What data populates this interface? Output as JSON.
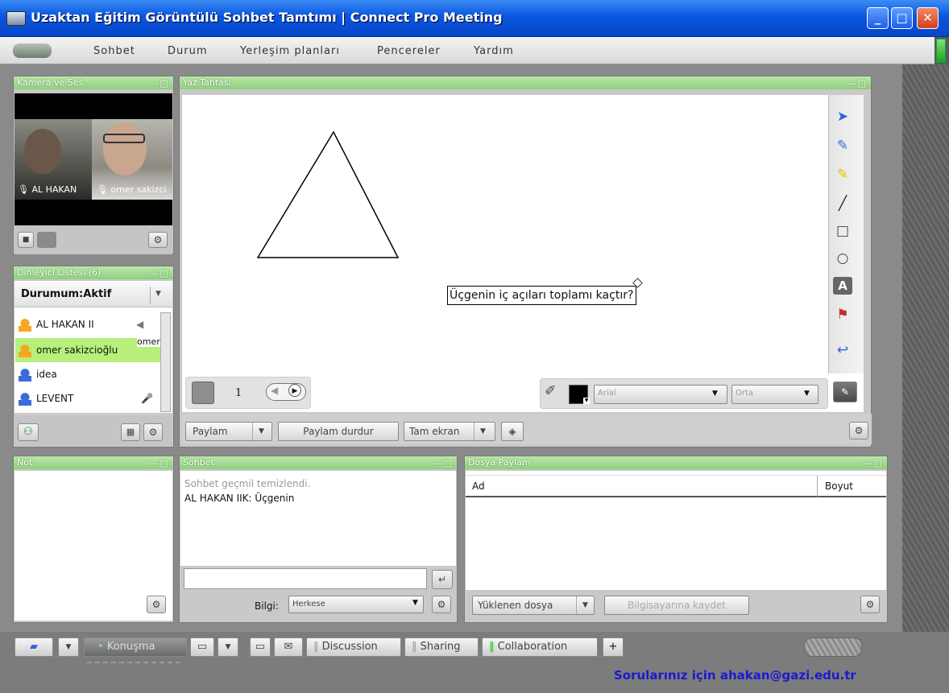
{
  "window": {
    "title": "Uzaktan Eğitim Görüntülü Sohbet Tamtımı | Connect Pro Meeting",
    "minimize_glyph": "_",
    "maximize_glyph": "□",
    "close_glyph": "✕"
  },
  "menu": {
    "items": [
      "Sohbet",
      "Durum",
      "Yerleşim planları",
      "Pencereler",
      "Yardım"
    ]
  },
  "camera_pod": {
    "title": "Kamera ve Ses",
    "participants": [
      "AL HAKAN",
      "omer sakizci"
    ]
  },
  "audience_pod": {
    "title": "Dinleyici Listesi (6)",
    "status": "Durumum:Aktif",
    "users": [
      {
        "name": "AL HAKAN II",
        "role": "host",
        "highlighted": false
      },
      {
        "name": "omer sakizcioğlu",
        "role": "host",
        "highlighted": true,
        "tooltip": "omer s."
      },
      {
        "name": "idea",
        "role": "participant",
        "highlighted": false
      },
      {
        "name": "LEVENT",
        "role": "participant",
        "highlighted": false
      }
    ]
  },
  "whiteboard_pod": {
    "title": "Yaz Tahtası",
    "text_note": "Üçgenin iç açıları toplamı kaçtır?",
    "page_number": "1",
    "font": "Arial",
    "size": "Orta",
    "fill_color": "#000000"
  },
  "share_bar": {
    "share": "Paylam",
    "stop": "Paylam durdur",
    "fullscreen": "Tam ekran"
  },
  "notes_pod": {
    "title": "Not"
  },
  "chat_pod": {
    "title": "Sohbet",
    "system_message": "Sohbet geçmil temizlendi.",
    "messages": [
      "AL HAKAN IIK: Üçgenin"
    ],
    "info_label": "Bilgi:",
    "recipient": "Herkese",
    "send_glyph": "↵"
  },
  "files_pod": {
    "title": "Dosya Paylam",
    "columns": [
      "Ad",
      "Boyut"
    ],
    "upload": "Yüklenen dosya",
    "save": "Bilgisayarına kaydet"
  },
  "bottom_bar": {
    "layout_tabs": [
      "Konuşma",
      "Discussion",
      "Sharing",
      "Collaboration"
    ],
    "add_glyph": "+",
    "contact": "Sorularınız için ahakan@gazi.edu.tr"
  },
  "colors": {
    "pod_header": "#8fd07e",
    "highlight_row": "#b6f07a",
    "contact_text": "#1a1ad0"
  }
}
